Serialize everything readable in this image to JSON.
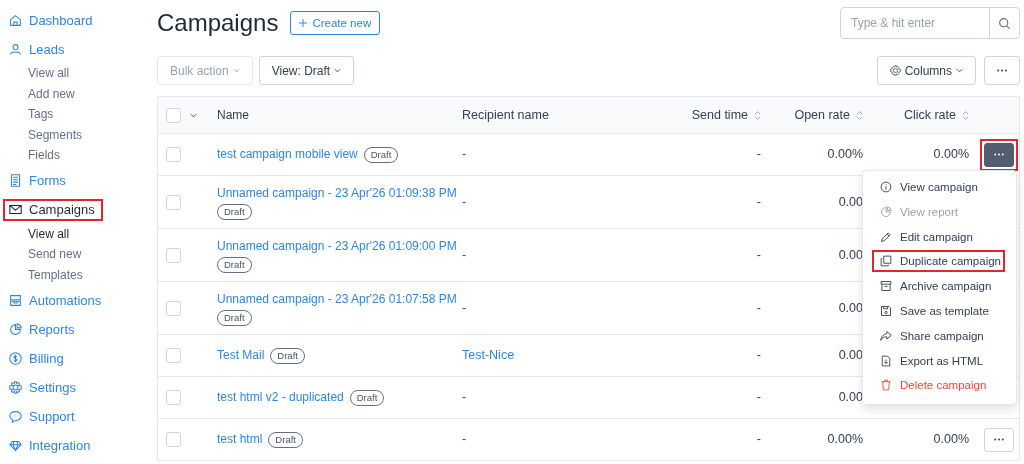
{
  "sidebar": {
    "items": [
      {
        "label": "Dashboard",
        "active": false,
        "highlighted": false
      },
      {
        "label": "Leads",
        "active": false,
        "highlighted": false,
        "children": [
          {
            "label": "View all",
            "active": false
          },
          {
            "label": "Add new",
            "active": false
          },
          {
            "label": "Tags",
            "active": false
          },
          {
            "label": "Segments",
            "active": false
          },
          {
            "label": "Fields",
            "active": false
          }
        ]
      },
      {
        "label": "Forms",
        "active": false,
        "highlighted": false
      },
      {
        "label": "Campaigns",
        "active": true,
        "highlighted": true,
        "children": [
          {
            "label": "View all",
            "active": true
          },
          {
            "label": "Send new",
            "active": false
          },
          {
            "label": "Templates",
            "active": false
          }
        ]
      },
      {
        "label": "Automations",
        "active": false,
        "highlighted": false
      },
      {
        "label": "Reports",
        "active": false,
        "highlighted": false
      },
      {
        "label": "Billing",
        "active": false,
        "highlighted": false
      },
      {
        "label": "Settings",
        "active": false,
        "highlighted": false
      },
      {
        "label": "Support",
        "active": false,
        "highlighted": false
      },
      {
        "label": "Integration",
        "active": false,
        "highlighted": false
      }
    ]
  },
  "page_title": "Campaigns",
  "create_button": "Create new",
  "search": {
    "placeholder": "Type & hit enter"
  },
  "toolbar": {
    "bulk_action": {
      "label": "Bulk action",
      "disabled": true
    },
    "view": "View: Draft",
    "columns": "Columns"
  },
  "table": {
    "all_checked": false,
    "columns": [
      {
        "label": "Name",
        "sortable": false
      },
      {
        "label": "Recipient name",
        "sortable": false
      },
      {
        "label": "Send time",
        "sortable": true
      },
      {
        "label": "Open rate",
        "sortable": true
      },
      {
        "label": "Click rate",
        "sortable": true
      }
    ],
    "rows": [
      {
        "name": "test campaign mobile view",
        "status": "Draft",
        "recipient": "-",
        "recipient_link": false,
        "send_time": "-",
        "open_rate": "0.00%",
        "click_rate": "0.00%",
        "checked": false,
        "action_button": {
          "open": true
        }
      },
      {
        "name": "Unnamed campaign - 23 Apr'26 01:09:38 PM",
        "status": "Draft",
        "recipient": "-",
        "recipient_link": false,
        "send_time": "-",
        "open_rate": "0.00",
        "checked": false
      },
      {
        "name": "Unnamed campaign - 23 Apr'26 01:09:00 PM",
        "status": "Draft",
        "recipient": "-",
        "recipient_link": false,
        "send_time": "-",
        "open_rate": "0.00",
        "checked": false
      },
      {
        "name": "Unnamed campaign - 23 Apr'26 01:07:58 PM",
        "status": "Draft",
        "recipient": "-",
        "recipient_link": false,
        "send_time": "-",
        "open_rate": "0.00",
        "checked": false
      },
      {
        "name": "Test Mail",
        "status": "Draft",
        "recipient": "Test-Nice",
        "recipient_link": true,
        "send_time": "-",
        "open_rate": "0.00",
        "checked": false
      },
      {
        "name": "test html v2 - duplicated",
        "status": "Draft",
        "recipient": "-",
        "recipient_link": false,
        "send_time": "-",
        "open_rate": "0.00",
        "checked": false
      },
      {
        "name": "test html",
        "status": "Draft",
        "recipient": "-",
        "recipient_link": false,
        "send_time": "-",
        "open_rate": "0.00%",
        "click_rate": "0.00%",
        "checked": false,
        "action_button": {
          "open": false
        }
      }
    ]
  },
  "row_menu": {
    "items": [
      {
        "label": "View campaign",
        "kind": "normal",
        "disabled": false,
        "highlighted": false
      },
      {
        "label": "View report",
        "kind": "normal",
        "disabled": true,
        "highlighted": false
      },
      {
        "label": "Edit campaign",
        "kind": "normal",
        "disabled": false,
        "highlighted": false
      },
      {
        "label": "Duplicate campaign",
        "kind": "normal",
        "disabled": false,
        "highlighted": true
      },
      {
        "label": "Archive campaign",
        "kind": "normal",
        "disabled": false,
        "highlighted": false
      },
      {
        "label": "Save as template",
        "kind": "normal",
        "disabled": false,
        "highlighted": false
      },
      {
        "label": "Share campaign",
        "kind": "normal",
        "disabled": false,
        "highlighted": false
      },
      {
        "label": "Export as HTML",
        "kind": "normal",
        "disabled": false,
        "highlighted": false
      },
      {
        "label": "Delete campaign",
        "kind": "danger",
        "disabled": false,
        "highlighted": false
      }
    ]
  }
}
